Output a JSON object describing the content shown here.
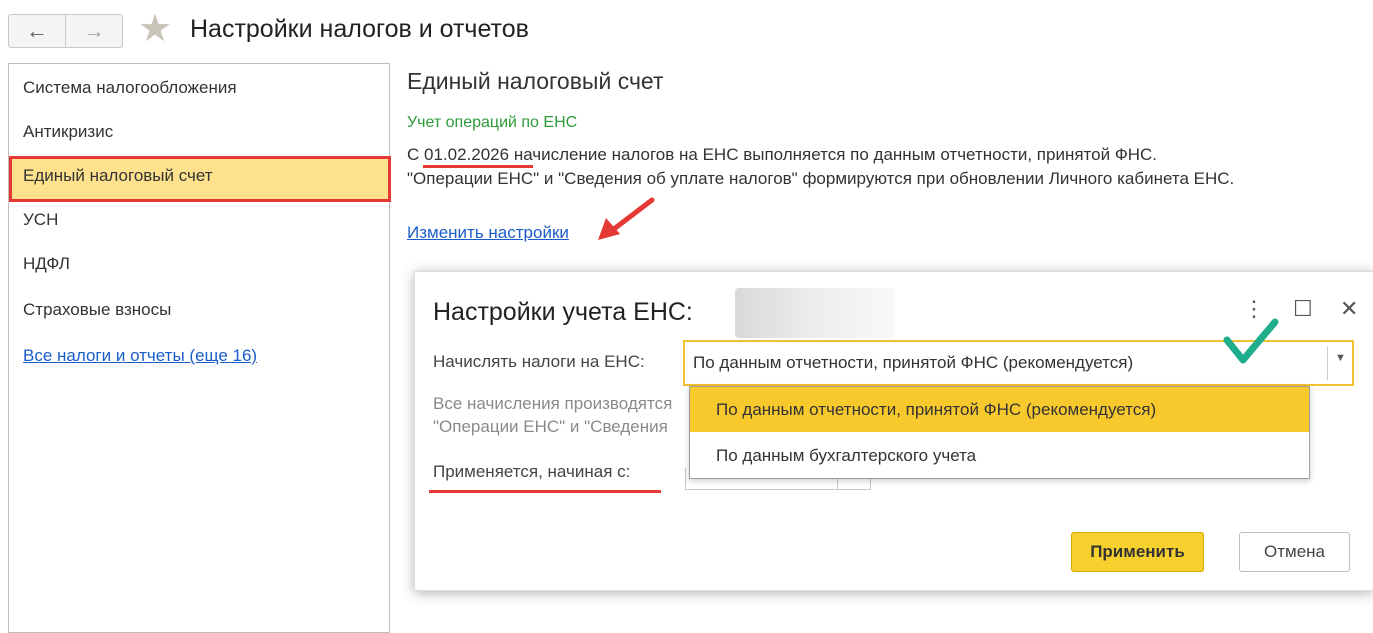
{
  "header": {
    "back_icon": "←",
    "forward_icon": "→",
    "favorite_icon": "★",
    "title": "Настройки налогов и отчетов"
  },
  "sidebar": {
    "items": [
      {
        "label": "Система налогообложения"
      },
      {
        "label": "Антикризис"
      },
      {
        "label": "Единый налоговый счет",
        "selected": true
      },
      {
        "label": "УСН"
      },
      {
        "label": "НДФЛ"
      },
      {
        "label": "Страховые взносы"
      }
    ],
    "all_link": "Все налоги и отчеты (еще 16)"
  },
  "main": {
    "section_title": "Единый налоговый счет",
    "subtitle": "Учет операций по ЕНС",
    "line1_prefix": "С ",
    "line1_date": "01.02.2026",
    "line1_rest": " начисление налогов на ЕНС выполняется по данным отчетности, принятой ФНС.",
    "line2": "\"Операции ЕНС\" и \"Сведения об уплате налогов\" формируются при обновлении Личного кабинета ЕНС.",
    "change_link": "Изменить настройки"
  },
  "dialog": {
    "title": "Настройки учета ЕНС:",
    "more_icon": "⋮",
    "maximize_icon": "☐",
    "close_icon": "✕",
    "accrue_label": "Начислять налоги на ЕНС:",
    "accrue_value": "По данным отчетности, принятой ФНС (рекомендуется)",
    "dropdown_arrow": "▼",
    "grey_line1": "Все начисления производятся",
    "grey_line2": "\"Операции ЕНС\" и \"Сведения",
    "applies_label": "Применяется, начиная с:",
    "apply_button": "Применить",
    "cancel_button": "Отмена",
    "options": [
      "По данным отчетности, принятой ФНС (рекомендуется)",
      "По данным бухгалтерского учета"
    ]
  },
  "colors": {
    "accent_yellow": "#f8c92d",
    "highlight_red": "#e53935",
    "link_blue": "#1a5dc9",
    "green_text": "#2e9b3a",
    "check_green": "#1fae8c"
  }
}
